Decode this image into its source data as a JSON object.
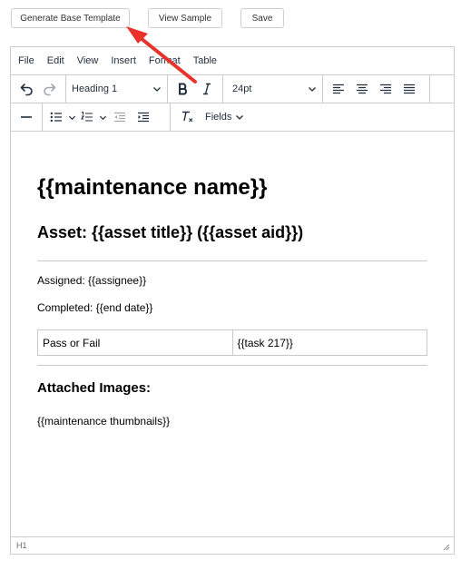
{
  "top_buttons": {
    "generate": "Generate Base Template",
    "view": "View Sample",
    "save": "Save"
  },
  "menubar": {
    "file": "File",
    "edit": "Edit",
    "view": "View",
    "insert": "Insert",
    "format": "Format",
    "table": "Table"
  },
  "toolbar": {
    "block_format": "Heading 1",
    "font_size": "24pt",
    "fields": "Fields"
  },
  "document": {
    "heading1": "{{maintenance name}}",
    "heading2": "Asset: {{asset title}} ({{asset aid}})",
    "assigned": "Assigned: {{assignee}}",
    "completed": "Completed: {{end date}}",
    "table": [
      [
        "Pass or Fail",
        "{{task 217}}"
      ]
    ],
    "heading3": "Attached Images:",
    "thumbnails": "{{maintenance thumbnails}}"
  },
  "statusbar": {
    "path": "H1"
  },
  "colors": {
    "annotation_arrow": "#e8322b",
    "border": "#cccccc",
    "text": "#222f3e"
  }
}
